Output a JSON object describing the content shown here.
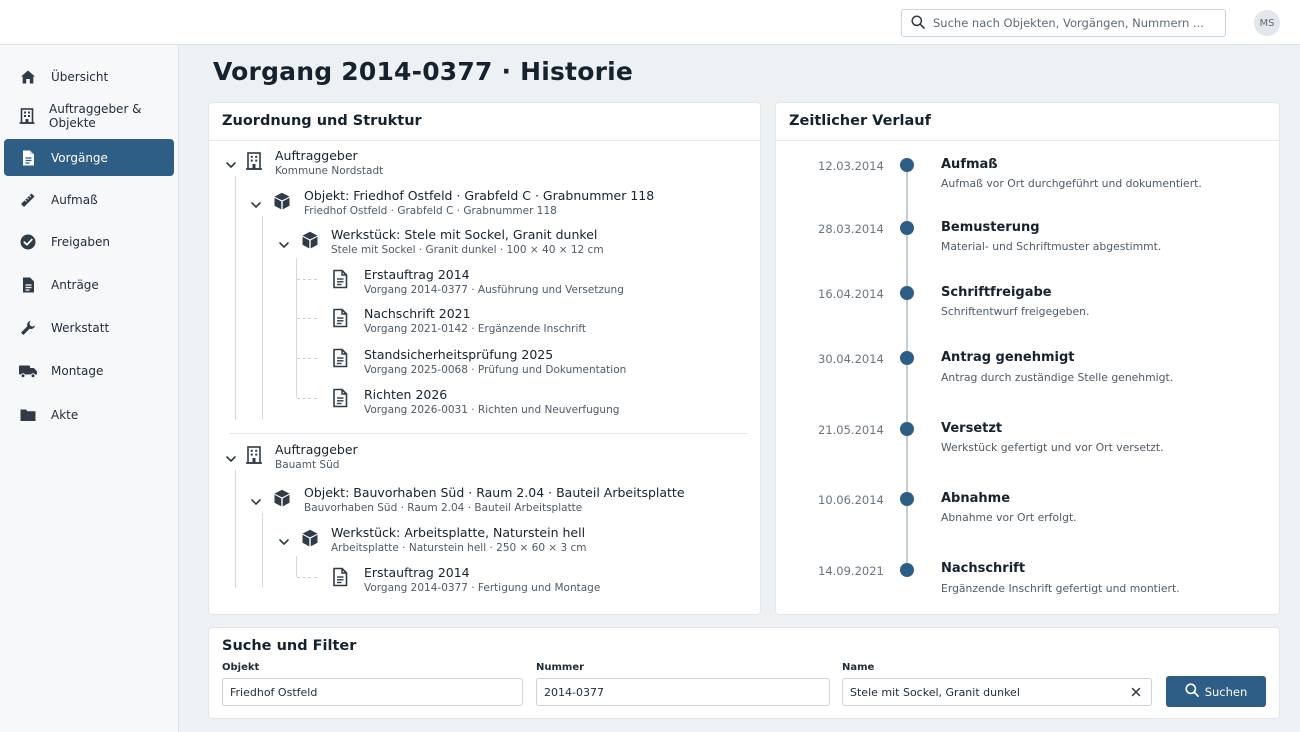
{
  "header": {
    "search_placeholder": "Suche nach Objekten, Vorgängen, Nummern ...",
    "avatar_initials": "MS"
  },
  "sidebar": {
    "items": [
      {
        "label": "Übersicht",
        "icon": "home-icon",
        "active": false
      },
      {
        "label": "Auftraggeber & Objekte",
        "icon": "building-icon",
        "active": false
      },
      {
        "label": "Vorgänge",
        "icon": "document-icon",
        "active": true
      },
      {
        "label": "Aufmaß",
        "icon": "ruler-icon",
        "active": false
      },
      {
        "label": "Freigaben",
        "icon": "check-circle-icon",
        "active": false
      },
      {
        "label": "Anträge",
        "icon": "document-icon",
        "active": false
      },
      {
        "label": "Werkstatt",
        "icon": "wrench-icon",
        "active": false
      },
      {
        "label": "Montage",
        "icon": "truck-icon",
        "active": false
      },
      {
        "label": "Akte",
        "icon": "folder-icon",
        "active": false
      }
    ]
  },
  "page_title": "Vorgang 2014-0377 · Historie",
  "structure": {
    "title": "Zuordnung und Struktur",
    "clients": [
      {
        "label": "Auftraggeber",
        "name": "Kommune Nordstadt",
        "object": {
          "title": "Objekt: Friedhof Ostfeld · Grabfeld C · Grabnummer 118",
          "sub": "Friedhof Ostfeld · Grabfeld C · Grabnummer 118",
          "workpiece": {
            "title": "Werkstück: Stele mit Sockel, Granit dunkel",
            "sub": "Stele mit Sockel · Granit dunkel · 100 × 40 × 12 cm",
            "orders": [
              {
                "title": "Erstauftrag 2014",
                "sub": "Vorgang 2014-0377 · Ausführung und Versetzung"
              },
              {
                "title": "Nachschrift 2021",
                "sub": "Vorgang 2021-0142 · Ergänzende Inschrift"
              },
              {
                "title": "Standsicherheitsprüfung 2025",
                "sub": "Vorgang 2025-0068 · Prüfung und Dokumentation"
              },
              {
                "title": "Richten 2026",
                "sub": "Vorgang 2026-0031 · Richten und Neuverfugung"
              }
            ]
          }
        }
      },
      {
        "label": "Auftraggeber",
        "name": "Bauamt Süd",
        "object": {
          "title": "Objekt: Bauvorhaben Süd · Raum 2.04 · Bauteil Arbeitsplatte",
          "sub": "Bauvorhaben Süd · Raum 2.04 · Bauteil Arbeitsplatte",
          "workpiece": {
            "title": "Werkstück: Arbeitsplatte, Naturstein hell",
            "sub": "Arbeitsplatte · Naturstein hell · 250 × 60 × 3 cm",
            "orders": [
              {
                "title": "Erstauftrag 2014",
                "sub": "Vorgang 2014-0377 · Fertigung und Montage"
              }
            ]
          }
        }
      }
    ]
  },
  "timeline": {
    "title": "Zeitlicher Verlauf",
    "events": [
      {
        "date": "12.03.2014",
        "title": "Aufmaß",
        "desc": "Aufmaß vor Ort durchgeführt und dokumentiert."
      },
      {
        "date": "28.03.2014",
        "title": "Bemusterung",
        "desc": "Material- und Schriftmuster abgestimmt."
      },
      {
        "date": "16.04.2014",
        "title": "Schriftfreigabe",
        "desc": "Schriftentwurf freigegeben."
      },
      {
        "date": "30.04.2014",
        "title": "Antrag genehmigt",
        "desc": "Antrag durch zuständige Stelle genehmigt."
      },
      {
        "date": "21.05.2014",
        "title": "Versetzt",
        "desc": "Werkstück gefertigt und vor Ort versetzt."
      },
      {
        "date": "10.06.2014",
        "title": "Abnahme",
        "desc": "Abnahme vor Ort erfolgt."
      },
      {
        "date": "14.09.2021",
        "title": "Nachschrift",
        "desc": "Ergänzende Inschrift gefertigt und montiert."
      }
    ]
  },
  "filter": {
    "title": "Suche und Filter",
    "object_label": "Objekt",
    "object_value": "Friedhof Ostfeld",
    "number_label": "Nummer",
    "number_value": "2014-0377",
    "name_label": "Name",
    "name_value": "Stele mit Sockel, Granit dunkel",
    "search_button": "Suchen"
  },
  "colors": {
    "accent": "#2e5d86",
    "background": "#eef1f4"
  }
}
